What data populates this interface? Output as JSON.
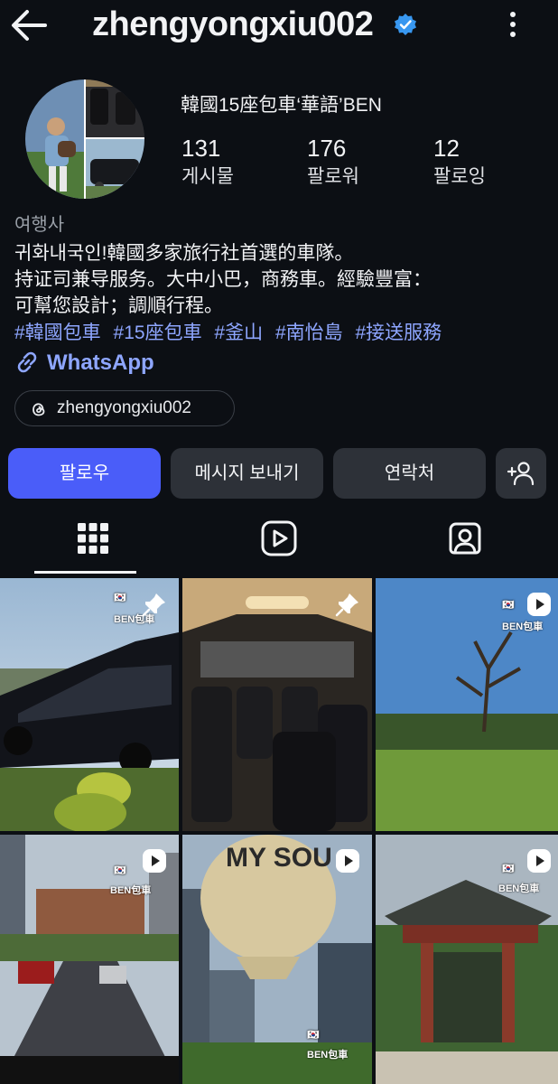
{
  "header": {
    "username": "zhengyongxiu002",
    "verified": true,
    "back_icon": "arrow-left-icon",
    "more_icon": "more-vertical-icon"
  },
  "profile": {
    "display_name": "韓國15座包車‘華語’BEN",
    "stats": [
      {
        "value": "131",
        "label": "게시물"
      },
      {
        "value": "176",
        "label": "팔로워"
      },
      {
        "value": "12",
        "label": "팔로잉"
      }
    ],
    "category": "여행사",
    "bio_lines": [
      "귀화내국인!韓國多家旅行社首選的車隊。",
      "持证司兼导服务。大中小巴，商務車。經驗豐富：",
      "可幫您設計；調順行程。"
    ],
    "hashtags": [
      "#韓國包車",
      "#15座包車",
      "#釜山",
      "#南怡島",
      "#接送服務"
    ],
    "link_label": "WhatsApp",
    "threads_handle": "zhengyongxiu002"
  },
  "actions": {
    "follow": "팔로우",
    "message": "메시지 보내기",
    "contact": "연락처",
    "add_person_icon": "add-person-icon"
  },
  "tabs": [
    {
      "icon": "grid-icon",
      "selected": true
    },
    {
      "icon": "reels-icon",
      "selected": false
    },
    {
      "icon": "tagged-icon",
      "selected": false
    }
  ],
  "grid": {
    "watermark": "BEN包車",
    "posts": [
      {
        "subject": "black van",
        "overlay": "pin-icon"
      },
      {
        "subject": "van interior seats",
        "overlay": "pin-icon"
      },
      {
        "subject": "tree in meadow",
        "overlay": "reel-icon"
      },
      {
        "subject": "city road",
        "overlay": "reel-icon"
      },
      {
        "subject": "balloon",
        "overlay": "reel-icon"
      },
      {
        "subject": "korean gate",
        "overlay": "reel-icon"
      }
    ],
    "balloon_text": "MY SOU"
  },
  "colors": {
    "background": "#0c0f14",
    "accent": "#4a5df9",
    "link": "#8ea6ff",
    "verified": "#3897f0"
  }
}
